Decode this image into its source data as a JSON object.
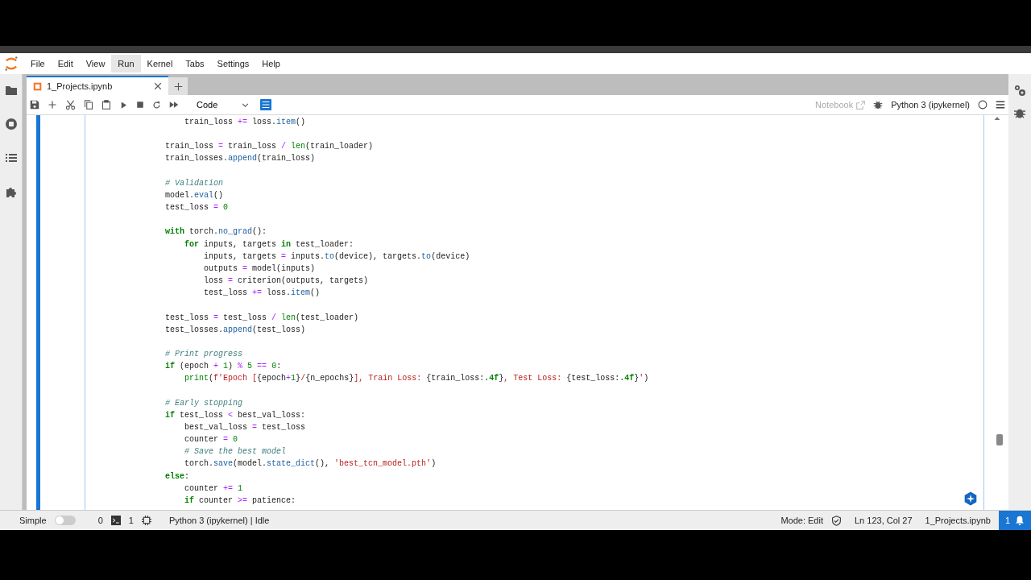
{
  "menu": [
    {
      "label": "File",
      "highlighted": false
    },
    {
      "label": "Edit",
      "highlighted": false
    },
    {
      "label": "View",
      "highlighted": false
    },
    {
      "label": "Run",
      "highlighted": true
    },
    {
      "label": "Kernel",
      "highlighted": false
    },
    {
      "label": "Tabs",
      "highlighted": false
    },
    {
      "label": "Settings",
      "highlighted": false
    },
    {
      "label": "Help",
      "highlighted": false
    }
  ],
  "tabs": [
    {
      "label": "1_Projects.ipynb",
      "selected": true
    }
  ],
  "toolbar": {
    "cell_type": "Code",
    "notebook_link": "Notebook",
    "kernel": "Python 3 (ipykernel)"
  },
  "code_blocks": [
    {
      "lines": [
        {
          "segments": [
            {
              "kind": "plain",
              "text": "            train_loss "
            },
            {
              "kind": "op",
              "text": "+="
            },
            {
              "kind": "plain",
              "text": " loss."
            },
            {
              "kind": "fn",
              "text": "item"
            },
            {
              "kind": "plain",
              "text": "()"
            }
          ]
        }
      ]
    },
    {
      "lines": [
        {
          "segments": [
            {
              "kind": "plain",
              "text": "        train_loss "
            },
            {
              "kind": "op",
              "text": "="
            },
            {
              "kind": "plain",
              "text": " train_loss "
            },
            {
              "kind": "op",
              "text": "/"
            },
            {
              "kind": "builtin",
              "text": " len"
            },
            {
              "kind": "plain",
              "text": "(train_loader)"
            }
          ]
        },
        {
          "segments": [
            {
              "kind": "plain",
              "text": "        train_losses."
            },
            {
              "kind": "fn",
              "text": "append"
            },
            {
              "kind": "plain",
              "text": "(train_loss)"
            }
          ]
        }
      ]
    },
    {
      "lines": [
        {
          "segments": [
            {
              "kind": "comment",
              "text": "        # Validation"
            }
          ]
        },
        {
          "segments": [
            {
              "kind": "plain",
              "text": "        model."
            },
            {
              "kind": "fn",
              "text": "eval"
            },
            {
              "kind": "plain",
              "text": "()"
            }
          ]
        },
        {
          "segments": [
            {
              "kind": "plain",
              "text": "        test_loss "
            },
            {
              "kind": "op",
              "text": "="
            },
            {
              "kind": "num",
              "text": " 0"
            }
          ]
        }
      ]
    },
    {
      "lines": [
        {
          "segments": [
            {
              "kind": "kw",
              "text": "        with"
            },
            {
              "kind": "plain",
              "text": " torch."
            },
            {
              "kind": "fn",
              "text": "no_grad"
            },
            {
              "kind": "plain",
              "text": "():"
            }
          ]
        },
        {
          "segments": [
            {
              "kind": "kw",
              "text": "            for"
            },
            {
              "kind": "plain",
              "text": " inputs, targets "
            },
            {
              "kind": "kw",
              "text": "in"
            },
            {
              "kind": "plain",
              "text": " test_loader:"
            }
          ]
        },
        {
          "segments": [
            {
              "kind": "plain",
              "text": "                inputs, targets "
            },
            {
              "kind": "op",
              "text": "="
            },
            {
              "kind": "plain",
              "text": " inputs."
            },
            {
              "kind": "fn",
              "text": "to"
            },
            {
              "kind": "plain",
              "text": "(device), targets."
            },
            {
              "kind": "fn",
              "text": "to"
            },
            {
              "kind": "plain",
              "text": "(device)"
            }
          ]
        },
        {
          "segments": [
            {
              "kind": "plain",
              "text": "                outputs "
            },
            {
              "kind": "op",
              "text": "="
            },
            {
              "kind": "plain",
              "text": " model(inputs)"
            }
          ]
        },
        {
          "segments": [
            {
              "kind": "plain",
              "text": "                loss "
            },
            {
              "kind": "op",
              "text": "="
            },
            {
              "kind": "plain",
              "text": " criterion(outputs, targets)"
            }
          ]
        },
        {
          "segments": [
            {
              "kind": "plain",
              "text": "                test_loss "
            },
            {
              "kind": "op",
              "text": "+="
            },
            {
              "kind": "plain",
              "text": " loss."
            },
            {
              "kind": "fn",
              "text": "item"
            },
            {
              "kind": "plain",
              "text": "()"
            }
          ]
        }
      ]
    },
    {
      "lines": [
        {
          "segments": [
            {
              "kind": "plain",
              "text": "        test_loss "
            },
            {
              "kind": "op",
              "text": "="
            },
            {
              "kind": "plain",
              "text": " test_loss "
            },
            {
              "kind": "op",
              "text": "/"
            },
            {
              "kind": "builtin",
              "text": " len"
            },
            {
              "kind": "plain",
              "text": "(test_loader)"
            }
          ]
        },
        {
          "segments": [
            {
              "kind": "plain",
              "text": "        test_losses."
            },
            {
              "kind": "fn",
              "text": "append"
            },
            {
              "kind": "plain",
              "text": "(test_loss)"
            }
          ]
        }
      ]
    },
    {
      "lines": [
        {
          "segments": [
            {
              "kind": "comment",
              "text": "        # Print progress"
            }
          ]
        },
        {
          "segments": [
            {
              "kind": "kw",
              "text": "        if"
            },
            {
              "kind": "plain",
              "text": " (epoch "
            },
            {
              "kind": "op",
              "text": "+"
            },
            {
              "kind": "num",
              "text": " 1"
            },
            {
              "kind": "plain",
              "text": ") "
            },
            {
              "kind": "op",
              "text": "%"
            },
            {
              "kind": "num",
              "text": " 5"
            },
            {
              "kind": "op",
              "text": " =="
            },
            {
              "kind": "num",
              "text": " 0"
            },
            {
              "kind": "plain",
              "text": ":"
            }
          ]
        },
        {
          "segments": [
            {
              "kind": "builtin",
              "text": "            print"
            },
            {
              "kind": "plain",
              "text": "("
            },
            {
              "kind": "str",
              "text": "f'Epoch ["
            },
            {
              "kind": "plain",
              "text": "{epoch"
            },
            {
              "kind": "op",
              "text": "+"
            },
            {
              "kind": "num",
              "text": "1"
            },
            {
              "kind": "plain",
              "text": "}"
            },
            {
              "kind": "str",
              "text": "/"
            },
            {
              "kind": "plain",
              "text": "{n_epochs}"
            },
            {
              "kind": "str",
              "text": "], Train Loss: "
            },
            {
              "kind": "plain",
              "text": "{train_loss:"
            },
            {
              "kind": "kw",
              "text": ".4f"
            },
            {
              "kind": "plain",
              "text": "}"
            },
            {
              "kind": "str",
              "text": ", Test Loss: "
            },
            {
              "kind": "plain",
              "text": "{test_loss:"
            },
            {
              "kind": "kw",
              "text": ".4f"
            },
            {
              "kind": "plain",
              "text": "}"
            },
            {
              "kind": "str",
              "text": "'"
            },
            {
              "kind": "plain",
              "text": ")"
            }
          ]
        }
      ]
    },
    {
      "lines": [
        {
          "segments": [
            {
              "kind": "comment",
              "text": "        # Early stopping"
            }
          ]
        },
        {
          "segments": [
            {
              "kind": "kw",
              "text": "        if"
            },
            {
              "kind": "plain",
              "text": " test_loss "
            },
            {
              "kind": "op",
              "text": "<"
            },
            {
              "kind": "plain",
              "text": " best_val_loss:"
            }
          ]
        },
        {
          "segments": [
            {
              "kind": "plain",
              "text": "            best_val_loss "
            },
            {
              "kind": "op",
              "text": "="
            },
            {
              "kind": "plain",
              "text": " test_loss"
            }
          ]
        },
        {
          "segments": [
            {
              "kind": "plain",
              "text": "            counter "
            },
            {
              "kind": "op",
              "text": "="
            },
            {
              "kind": "num",
              "text": " 0"
            }
          ]
        },
        {
          "segments": [
            {
              "kind": "comment",
              "text": "            # Save the best model"
            }
          ]
        },
        {
          "segments": [
            {
              "kind": "plain",
              "text": "            torch."
            },
            {
              "kind": "fn",
              "text": "save"
            },
            {
              "kind": "plain",
              "text": "(model."
            },
            {
              "kind": "fn",
              "text": "state_dict"
            },
            {
              "kind": "plain",
              "text": "(), "
            },
            {
              "kind": "str",
              "text": "'best_tcn_model.pth'"
            },
            {
              "kind": "plain",
              "text": ")"
            }
          ]
        },
        {
          "segments": [
            {
              "kind": "kw",
              "text": "        else"
            },
            {
              "kind": "plain",
              "text": ":"
            }
          ]
        },
        {
          "segments": [
            {
              "kind": "plain",
              "text": "            counter "
            },
            {
              "kind": "op",
              "text": "+="
            },
            {
              "kind": "num",
              "text": " 1"
            }
          ]
        },
        {
          "segments": [
            {
              "kind": "kw",
              "text": "            if"
            },
            {
              "kind": "plain",
              "text": " counter "
            },
            {
              "kind": "op",
              "text": ">="
            },
            {
              "kind": "plain",
              "text": " patience:"
            }
          ]
        }
      ]
    }
  ],
  "status_bar": {
    "mode_label": "Simple",
    "simple_on": false,
    "terminals": "0",
    "kernels": "1",
    "kernel_status": "Python 3 (ipykernel) | Idle",
    "mode": "Mode: Edit",
    "cursor": "Ln 123, Col 27",
    "file": "1_Projects.ipynb",
    "notifications": "1"
  }
}
